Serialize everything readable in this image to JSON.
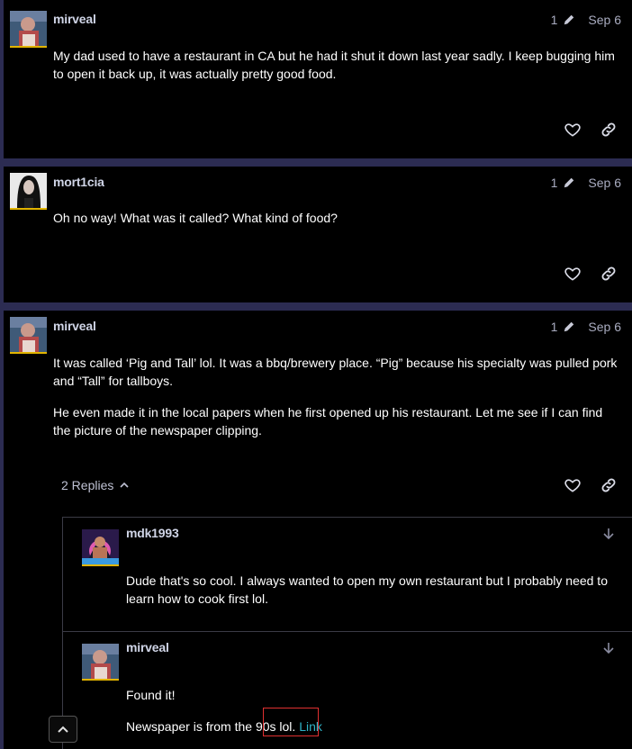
{
  "posts": [
    {
      "username": "mirveal",
      "edit_count": "1",
      "date": "Sep 6",
      "paragraphs": [
        "My dad used to have a restaurant in CA but he had it shut it down last year sadly. I keep bugging him to open it back up, it was actually pretty good food."
      ]
    },
    {
      "username": "mort1cia",
      "edit_count": "1",
      "date": "Sep 6",
      "paragraphs": [
        "Oh no way! What was it called? What kind of food?"
      ]
    },
    {
      "username": "mirveal",
      "edit_count": "1",
      "date": "Sep 6",
      "paragraphs": [
        "It was called ‘Pig and Tall’ lol. It was a bbq/brewery place. “Pig” because his specialty was pulled pork and “Tall” for tallboys.",
        "He even made it in the local papers when he first opened up his restaurant. Let me see if I can find the picture of the newspaper clipping."
      ],
      "replies_label": "2 Replies"
    }
  ],
  "replies": [
    {
      "username": "mdk1993",
      "paragraphs": [
        "Dude that's so cool. I always wanted to open my own restaurant but I probably need to learn how to cook first lol."
      ]
    },
    {
      "username": "mirveal",
      "line1": "Found it!",
      "line2_text": "Newspaper is from the 90s lol.",
      "link_label": "Link"
    }
  ],
  "icons": {
    "like": "heart-icon",
    "share": "link-icon",
    "edit": "pencil-icon",
    "expand": "arrow-down-icon",
    "collapse": "chevron-up-icon",
    "scroll_top": "chevron-up-icon"
  },
  "colors": {
    "background": "#000000",
    "divider": "#2c2c52",
    "link": "#2fb3c7",
    "avatar_underline": "#e2b400"
  }
}
